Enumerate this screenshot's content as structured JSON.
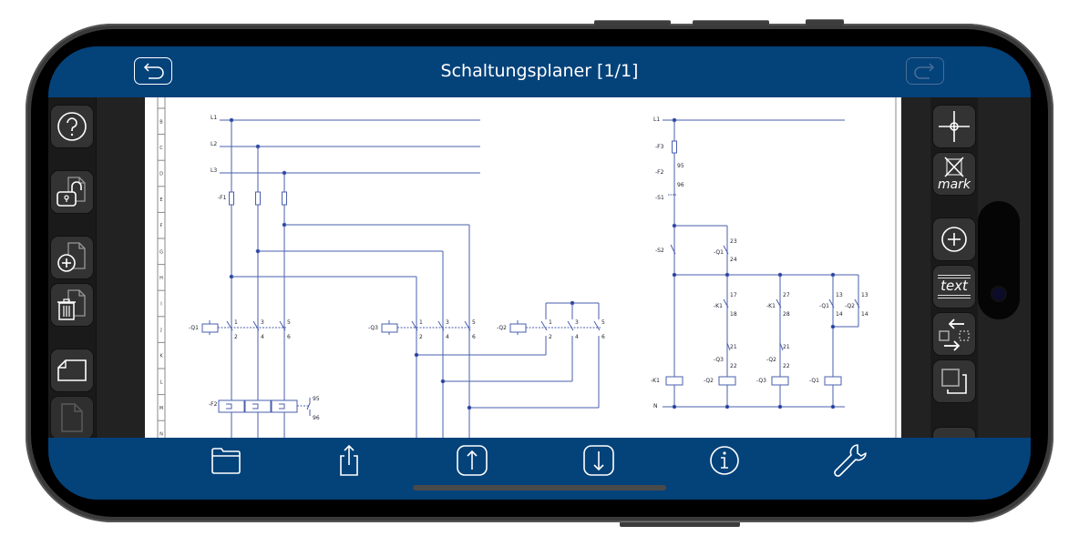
{
  "app": {
    "title": "Schaltungsplaner [1/1]",
    "undo_icon": "undo-icon",
    "redo_icon": "redo-icon",
    "accent_color": "#04427a"
  },
  "left_toolbar": [
    {
      "name": "help",
      "icon": "help-icon"
    },
    {
      "name": "unlock-sheet",
      "icon": "unlock-page-icon"
    },
    {
      "name": "add-sheet",
      "icon": "add-page-icon"
    },
    {
      "name": "delete-sheet",
      "icon": "delete-page-icon"
    },
    {
      "name": "page-format",
      "icon": "page-landscape-icon"
    },
    {
      "name": "page-portrait",
      "icon": "page-portrait-icon",
      "disabled": true
    }
  ],
  "right_toolbar": [
    {
      "name": "crosshair",
      "icon": "crosshair-icon"
    },
    {
      "name": "mark",
      "icon": "mark-icon",
      "label": "mark"
    },
    {
      "name": "add-element",
      "icon": "plus-circle-icon"
    },
    {
      "name": "text",
      "icon": "text-icon",
      "label": "text"
    },
    {
      "name": "move",
      "icon": "move-icon"
    },
    {
      "name": "duplicate",
      "icon": "duplicate-icon"
    }
  ],
  "bottom_toolbar": [
    {
      "name": "open",
      "icon": "folder-icon"
    },
    {
      "name": "share",
      "icon": "share-icon"
    },
    {
      "name": "move-up",
      "icon": "arrow-up-icon"
    },
    {
      "name": "move-down",
      "icon": "arrow-down-icon"
    },
    {
      "name": "info",
      "icon": "info-icon"
    },
    {
      "name": "settings",
      "icon": "wrench-icon"
    }
  ],
  "sheet": {
    "row_labels": [
      "B",
      "C",
      "D",
      "E",
      "F",
      "G",
      "H",
      "I",
      "J",
      "K",
      "L",
      "M",
      "N"
    ],
    "power_circuit": {
      "lines": [
        "L1",
        "L2",
        "L3"
      ],
      "fuse": "-F1",
      "contactors": [
        {
          "id": "-Q1",
          "contacts": [
            "1",
            "2",
            "3",
            "4",
            "5",
            "6"
          ]
        },
        {
          "id": "-Q3",
          "contacts": [
            "1",
            "2",
            "3",
            "4",
            "5",
            "6"
          ]
        },
        {
          "id": "-Q2",
          "contacts": [
            "1",
            "2",
            "3",
            "4",
            "5",
            "6"
          ]
        }
      ],
      "overload": {
        "id": "-F2",
        "contacts": [
          "95",
          "96"
        ]
      }
    },
    "control_circuit": {
      "supply": "L1",
      "neutral": "N",
      "fuse": "-F3",
      "overload_contact": {
        "id": "-F2",
        "top": "95",
        "bottom": "96"
      },
      "stop": "-S1",
      "start": "-S2",
      "hold_contact": {
        "id": "-Q1",
        "top": "23",
        "bottom": "24"
      },
      "timer_contacts": [
        {
          "id": "-K1",
          "top": "17",
          "bottom": "18"
        },
        {
          "id": "-K1",
          "top": "27",
          "bottom": "28"
        }
      ],
      "interlocks": [
        {
          "id": "-Q3",
          "top": "21",
          "bottom": "22"
        },
        {
          "id": "-Q2",
          "top": "21",
          "bottom": "22"
        }
      ],
      "aux_contacts": [
        {
          "id": "-Q1",
          "top": "13",
          "bottom": "14"
        },
        {
          "id": "-Q2",
          "top": "13",
          "bottom": "14"
        }
      ],
      "coils": [
        "-K1",
        "-Q2",
        "-Q3",
        "-Q1"
      ]
    }
  }
}
